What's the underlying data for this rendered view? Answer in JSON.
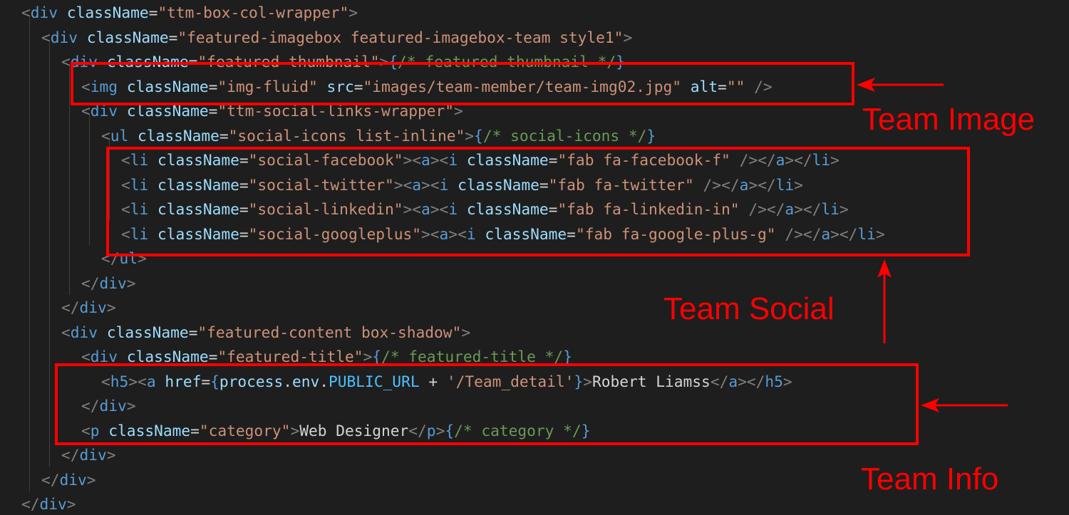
{
  "colors": {
    "background": "#1e1e1e",
    "tag": "#569cd6",
    "attribute": "#9cdcfe",
    "string": "#ce9178",
    "punctuation": "#808080",
    "comment": "#6a9955",
    "text": "#d4d4d4",
    "annotation": "#ff0000"
  },
  "code_lines": [
    {
      "id": "l0",
      "tokens": [
        [
          "punct",
          "<"
        ],
        [
          "tag",
          "div"
        ],
        [
          "text",
          " "
        ],
        [
          "attr",
          "className"
        ],
        [
          "text",
          "="
        ],
        [
          "str",
          "\"ttm-box-col-wrapper\""
        ],
        [
          "punct",
          ">"
        ]
      ]
    },
    {
      "id": "l1",
      "tokens": [
        [
          "punct",
          "<"
        ],
        [
          "tag",
          "div"
        ],
        [
          "text",
          " "
        ],
        [
          "attr",
          "className"
        ],
        [
          "text",
          "="
        ],
        [
          "str",
          "\"featured-imagebox featured-imagebox-team style1\""
        ],
        [
          "punct",
          ">"
        ]
      ]
    },
    {
      "id": "l2",
      "tokens": [
        [
          "punct",
          "<"
        ],
        [
          "tag",
          "div"
        ],
        [
          "text",
          " "
        ],
        [
          "attr",
          "className"
        ],
        [
          "text",
          "="
        ],
        [
          "str",
          "\"featured-thumbnail\""
        ],
        [
          "punct",
          ">"
        ],
        [
          "brace",
          "{"
        ],
        [
          "comment",
          "/* featured-thumbnail */"
        ],
        [
          "brace",
          "}"
        ]
      ]
    },
    {
      "id": "l3",
      "tokens": [
        [
          "punct",
          "<"
        ],
        [
          "tag",
          "img"
        ],
        [
          "text",
          " "
        ],
        [
          "attr",
          "className"
        ],
        [
          "text",
          "="
        ],
        [
          "str",
          "\"img-fluid\""
        ],
        [
          "text",
          " "
        ],
        [
          "attr",
          "src"
        ],
        [
          "text",
          "="
        ],
        [
          "str",
          "\"images/team-member/team-img02.jpg\""
        ],
        [
          "text",
          " "
        ],
        [
          "attr",
          "alt"
        ],
        [
          "text",
          "="
        ],
        [
          "str",
          "\"\""
        ],
        [
          "text",
          " "
        ],
        [
          "punct",
          "/>"
        ]
      ]
    },
    {
      "id": "l4",
      "tokens": [
        [
          "punct",
          "<"
        ],
        [
          "tag",
          "div"
        ],
        [
          "text",
          " "
        ],
        [
          "attr",
          "className"
        ],
        [
          "text",
          "="
        ],
        [
          "str",
          "\"ttm-social-links-wrapper\""
        ],
        [
          "punct",
          ">"
        ]
      ]
    },
    {
      "id": "l5",
      "tokens": [
        [
          "punct",
          "<"
        ],
        [
          "tag",
          "ul"
        ],
        [
          "text",
          " "
        ],
        [
          "attr",
          "className"
        ],
        [
          "text",
          "="
        ],
        [
          "str",
          "\"social-icons list-inline\""
        ],
        [
          "punct",
          ">"
        ],
        [
          "brace",
          "{"
        ],
        [
          "comment",
          "/* social-icons */"
        ],
        [
          "brace",
          "}"
        ]
      ]
    },
    {
      "id": "l6",
      "tokens": [
        [
          "punct",
          "<"
        ],
        [
          "tag",
          "li"
        ],
        [
          "text",
          " "
        ],
        [
          "attr",
          "className"
        ],
        [
          "text",
          "="
        ],
        [
          "str",
          "\"social-facebook\""
        ],
        [
          "punct",
          ">"
        ],
        [
          "punct",
          "<"
        ],
        [
          "tag",
          "a"
        ],
        [
          "punct",
          ">"
        ],
        [
          "punct",
          "<"
        ],
        [
          "tag",
          "i"
        ],
        [
          "text",
          " "
        ],
        [
          "attr",
          "className"
        ],
        [
          "text",
          "="
        ],
        [
          "str",
          "\"fab fa-facebook-f\""
        ],
        [
          "text",
          " "
        ],
        [
          "punct",
          "/>"
        ],
        [
          "punct",
          "</"
        ],
        [
          "tag",
          "a"
        ],
        [
          "punct",
          ">"
        ],
        [
          "punct",
          "</"
        ],
        [
          "tag",
          "li"
        ],
        [
          "punct",
          ">"
        ]
      ]
    },
    {
      "id": "l7",
      "tokens": [
        [
          "punct",
          "<"
        ],
        [
          "tag",
          "li"
        ],
        [
          "text",
          " "
        ],
        [
          "attr",
          "className"
        ],
        [
          "text",
          "="
        ],
        [
          "str",
          "\"social-twitter\""
        ],
        [
          "punct",
          ">"
        ],
        [
          "punct",
          "<"
        ],
        [
          "tag",
          "a"
        ],
        [
          "punct",
          ">"
        ],
        [
          "punct",
          "<"
        ],
        [
          "tag",
          "i"
        ],
        [
          "text",
          " "
        ],
        [
          "attr",
          "className"
        ],
        [
          "text",
          "="
        ],
        [
          "str",
          "\"fab fa-twitter\""
        ],
        [
          "text",
          " "
        ],
        [
          "punct",
          "/>"
        ],
        [
          "punct",
          "</"
        ],
        [
          "tag",
          "a"
        ],
        [
          "punct",
          ">"
        ],
        [
          "punct",
          "</"
        ],
        [
          "tag",
          "li"
        ],
        [
          "punct",
          ">"
        ]
      ]
    },
    {
      "id": "l8",
      "tokens": [
        [
          "punct",
          "<"
        ],
        [
          "tag",
          "li"
        ],
        [
          "text",
          " "
        ],
        [
          "attr",
          "className"
        ],
        [
          "text",
          "="
        ],
        [
          "str",
          "\"social-linkedin\""
        ],
        [
          "punct",
          ">"
        ],
        [
          "punct",
          "<"
        ],
        [
          "tag",
          "a"
        ],
        [
          "punct",
          ">"
        ],
        [
          "punct",
          "<"
        ],
        [
          "tag",
          "i"
        ],
        [
          "text",
          " "
        ],
        [
          "attr",
          "className"
        ],
        [
          "text",
          "="
        ],
        [
          "str",
          "\"fab fa-linkedin-in\""
        ],
        [
          "text",
          " "
        ],
        [
          "punct",
          "/>"
        ],
        [
          "punct",
          "</"
        ],
        [
          "tag",
          "a"
        ],
        [
          "punct",
          ">"
        ],
        [
          "punct",
          "</"
        ],
        [
          "tag",
          "li"
        ],
        [
          "punct",
          ">"
        ]
      ]
    },
    {
      "id": "l9",
      "tokens": [
        [
          "punct",
          "<"
        ],
        [
          "tag",
          "li"
        ],
        [
          "text",
          " "
        ],
        [
          "attr",
          "className"
        ],
        [
          "text",
          "="
        ],
        [
          "str",
          "\"social-googleplus\""
        ],
        [
          "punct",
          ">"
        ],
        [
          "punct",
          "<"
        ],
        [
          "tag",
          "a"
        ],
        [
          "punct",
          ">"
        ],
        [
          "punct",
          "<"
        ],
        [
          "tag",
          "i"
        ],
        [
          "text",
          " "
        ],
        [
          "attr",
          "className"
        ],
        [
          "text",
          "="
        ],
        [
          "str",
          "\"fab fa-google-plus-g\""
        ],
        [
          "text",
          " "
        ],
        [
          "punct",
          "/>"
        ],
        [
          "punct",
          "</"
        ],
        [
          "tag",
          "a"
        ],
        [
          "punct",
          ">"
        ],
        [
          "punct",
          "</"
        ],
        [
          "tag",
          "li"
        ],
        [
          "punct",
          ">"
        ]
      ]
    },
    {
      "id": "l10",
      "tokens": [
        [
          "punct",
          "</"
        ],
        [
          "tag",
          "ul"
        ],
        [
          "punct",
          ">"
        ]
      ]
    },
    {
      "id": "l11",
      "tokens": [
        [
          "punct",
          "</"
        ],
        [
          "tag",
          "div"
        ],
        [
          "punct",
          ">"
        ]
      ]
    },
    {
      "id": "l12",
      "tokens": [
        [
          "punct",
          "</"
        ],
        [
          "tag",
          "div"
        ],
        [
          "punct",
          ">"
        ]
      ]
    },
    {
      "id": "l13",
      "tokens": [
        [
          "punct",
          "<"
        ],
        [
          "tag",
          "div"
        ],
        [
          "text",
          " "
        ],
        [
          "attr",
          "className"
        ],
        [
          "text",
          "="
        ],
        [
          "str",
          "\"featured-content box-shadow\""
        ],
        [
          "punct",
          ">"
        ]
      ]
    },
    {
      "id": "l14",
      "tokens": [
        [
          "punct",
          "<"
        ],
        [
          "tag",
          "div"
        ],
        [
          "text",
          " "
        ],
        [
          "attr",
          "className"
        ],
        [
          "text",
          "="
        ],
        [
          "str",
          "\"featured-title\""
        ],
        [
          "punct",
          ">"
        ],
        [
          "brace",
          "{"
        ],
        [
          "comment",
          "/* featured-title */"
        ],
        [
          "brace",
          "}"
        ]
      ]
    },
    {
      "id": "l15",
      "tokens": [
        [
          "punct",
          "<"
        ],
        [
          "tag",
          "h5"
        ],
        [
          "punct",
          ">"
        ],
        [
          "punct",
          "<"
        ],
        [
          "tag",
          "a"
        ],
        [
          "text",
          " "
        ],
        [
          "attr",
          "href"
        ],
        [
          "text",
          "="
        ],
        [
          "brace",
          "{"
        ],
        [
          "var",
          "process"
        ],
        [
          "text",
          "."
        ],
        [
          "var",
          "env"
        ],
        [
          "text",
          "."
        ],
        [
          "const",
          "PUBLIC_URL"
        ],
        [
          "text",
          " + "
        ],
        [
          "str",
          "'/Team_detail'"
        ],
        [
          "brace",
          "}"
        ],
        [
          "punct",
          ">"
        ],
        [
          "text",
          "Robert Liamss"
        ],
        [
          "punct",
          "</"
        ],
        [
          "tag",
          "a"
        ],
        [
          "punct",
          ">"
        ],
        [
          "punct",
          "</"
        ],
        [
          "tag",
          "h5"
        ],
        [
          "punct",
          ">"
        ]
      ]
    },
    {
      "id": "l16",
      "tokens": [
        [
          "punct",
          "</"
        ],
        [
          "tag",
          "div"
        ],
        [
          "punct",
          ">"
        ]
      ]
    },
    {
      "id": "l17",
      "tokens": [
        [
          "punct",
          "<"
        ],
        [
          "tag",
          "p"
        ],
        [
          "text",
          " "
        ],
        [
          "attr",
          "className"
        ],
        [
          "text",
          "="
        ],
        [
          "str",
          "\"category\""
        ],
        [
          "punct",
          ">"
        ],
        [
          "text",
          "Web Designer"
        ],
        [
          "punct",
          "</"
        ],
        [
          "tag",
          "p"
        ],
        [
          "punct",
          ">"
        ],
        [
          "brace",
          "{"
        ],
        [
          "comment",
          "/* category */"
        ],
        [
          "brace",
          "}"
        ]
      ]
    },
    {
      "id": "l18",
      "tokens": [
        [
          "punct",
          "</"
        ],
        [
          "tag",
          "div"
        ],
        [
          "punct",
          ">"
        ]
      ]
    },
    {
      "id": "l19",
      "tokens": [
        [
          "punct",
          "</"
        ],
        [
          "tag",
          "div"
        ],
        [
          "punct",
          ">"
        ]
      ]
    },
    {
      "id": "l20",
      "tokens": [
        [
          "punct",
          "</"
        ],
        [
          "tag",
          "div"
        ],
        [
          "punct",
          ">"
        ]
      ]
    }
  ],
  "annotations": {
    "team_image": "Team Image",
    "team_social": "Team Social",
    "team_info": "Team Info"
  }
}
